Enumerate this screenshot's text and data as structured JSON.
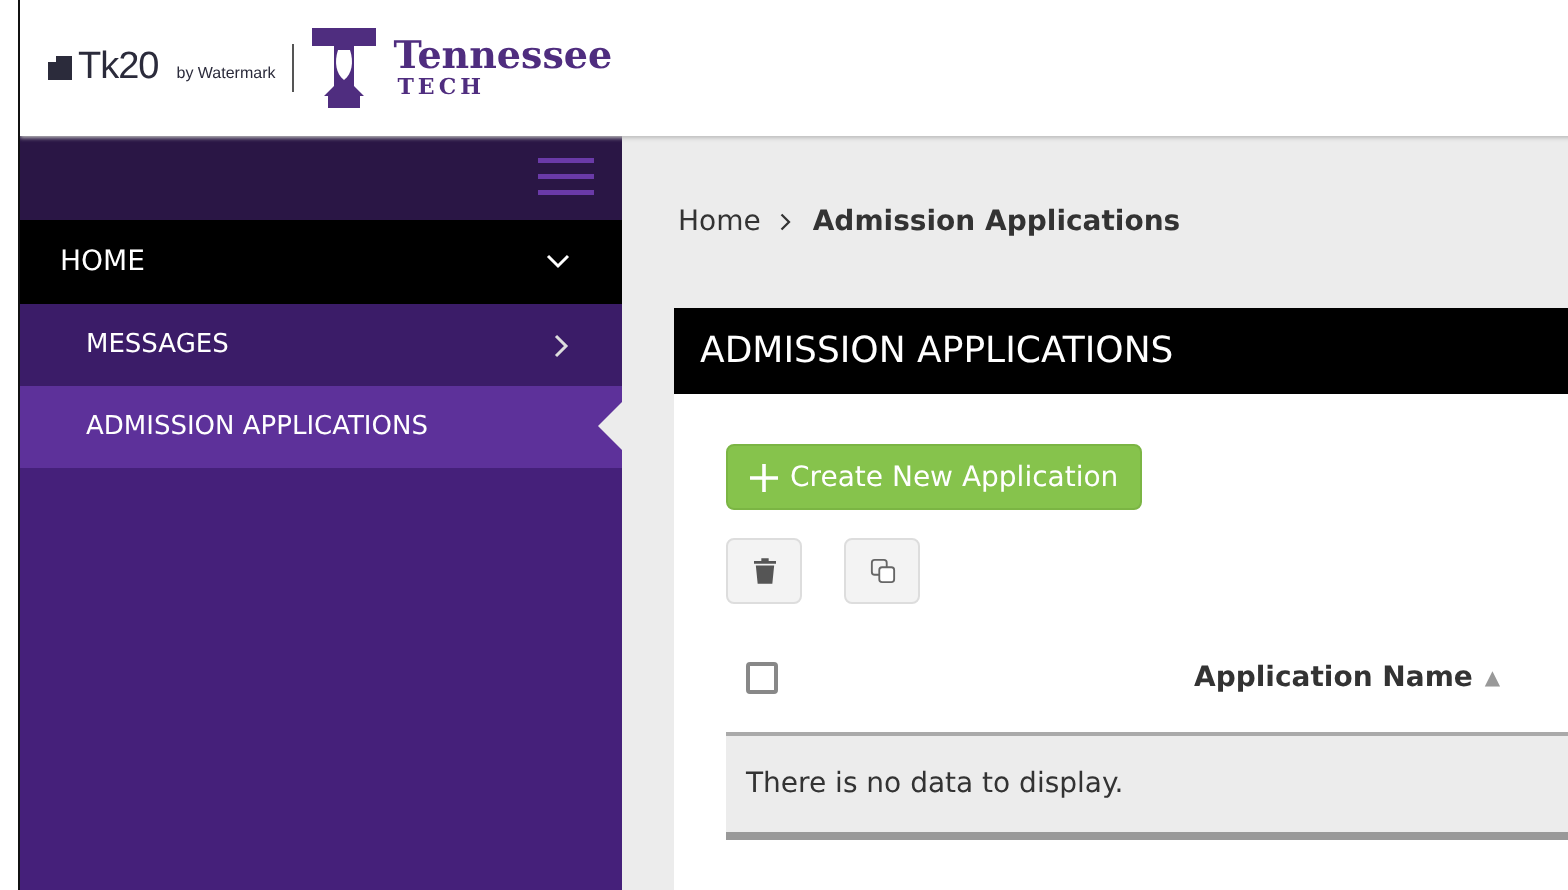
{
  "header": {
    "brand": "Tk20",
    "brand_suffix": "by Watermark",
    "school_name": "Tennessee",
    "school_sub": "TECH"
  },
  "sidebar": {
    "items": [
      {
        "label": "HOME",
        "kind": "section",
        "expanded": true,
        "selected": false
      },
      {
        "label": "MESSAGES",
        "kind": "link",
        "selected": false
      },
      {
        "label": "ADMISSION APPLICATIONS",
        "kind": "link",
        "selected": true
      }
    ]
  },
  "breadcrumb": [
    {
      "label": "Home",
      "current": false
    },
    {
      "label": "Admission Applications",
      "current": true
    }
  ],
  "panel": {
    "title": "ADMISSION APPLICATIONS",
    "create_button": "Create New Application",
    "table": {
      "select_all": {
        "checked": false
      },
      "columns": [
        {
          "label": "Application Name",
          "sort": "▲"
        }
      ],
      "empty_message": "There is no data to display."
    }
  }
}
